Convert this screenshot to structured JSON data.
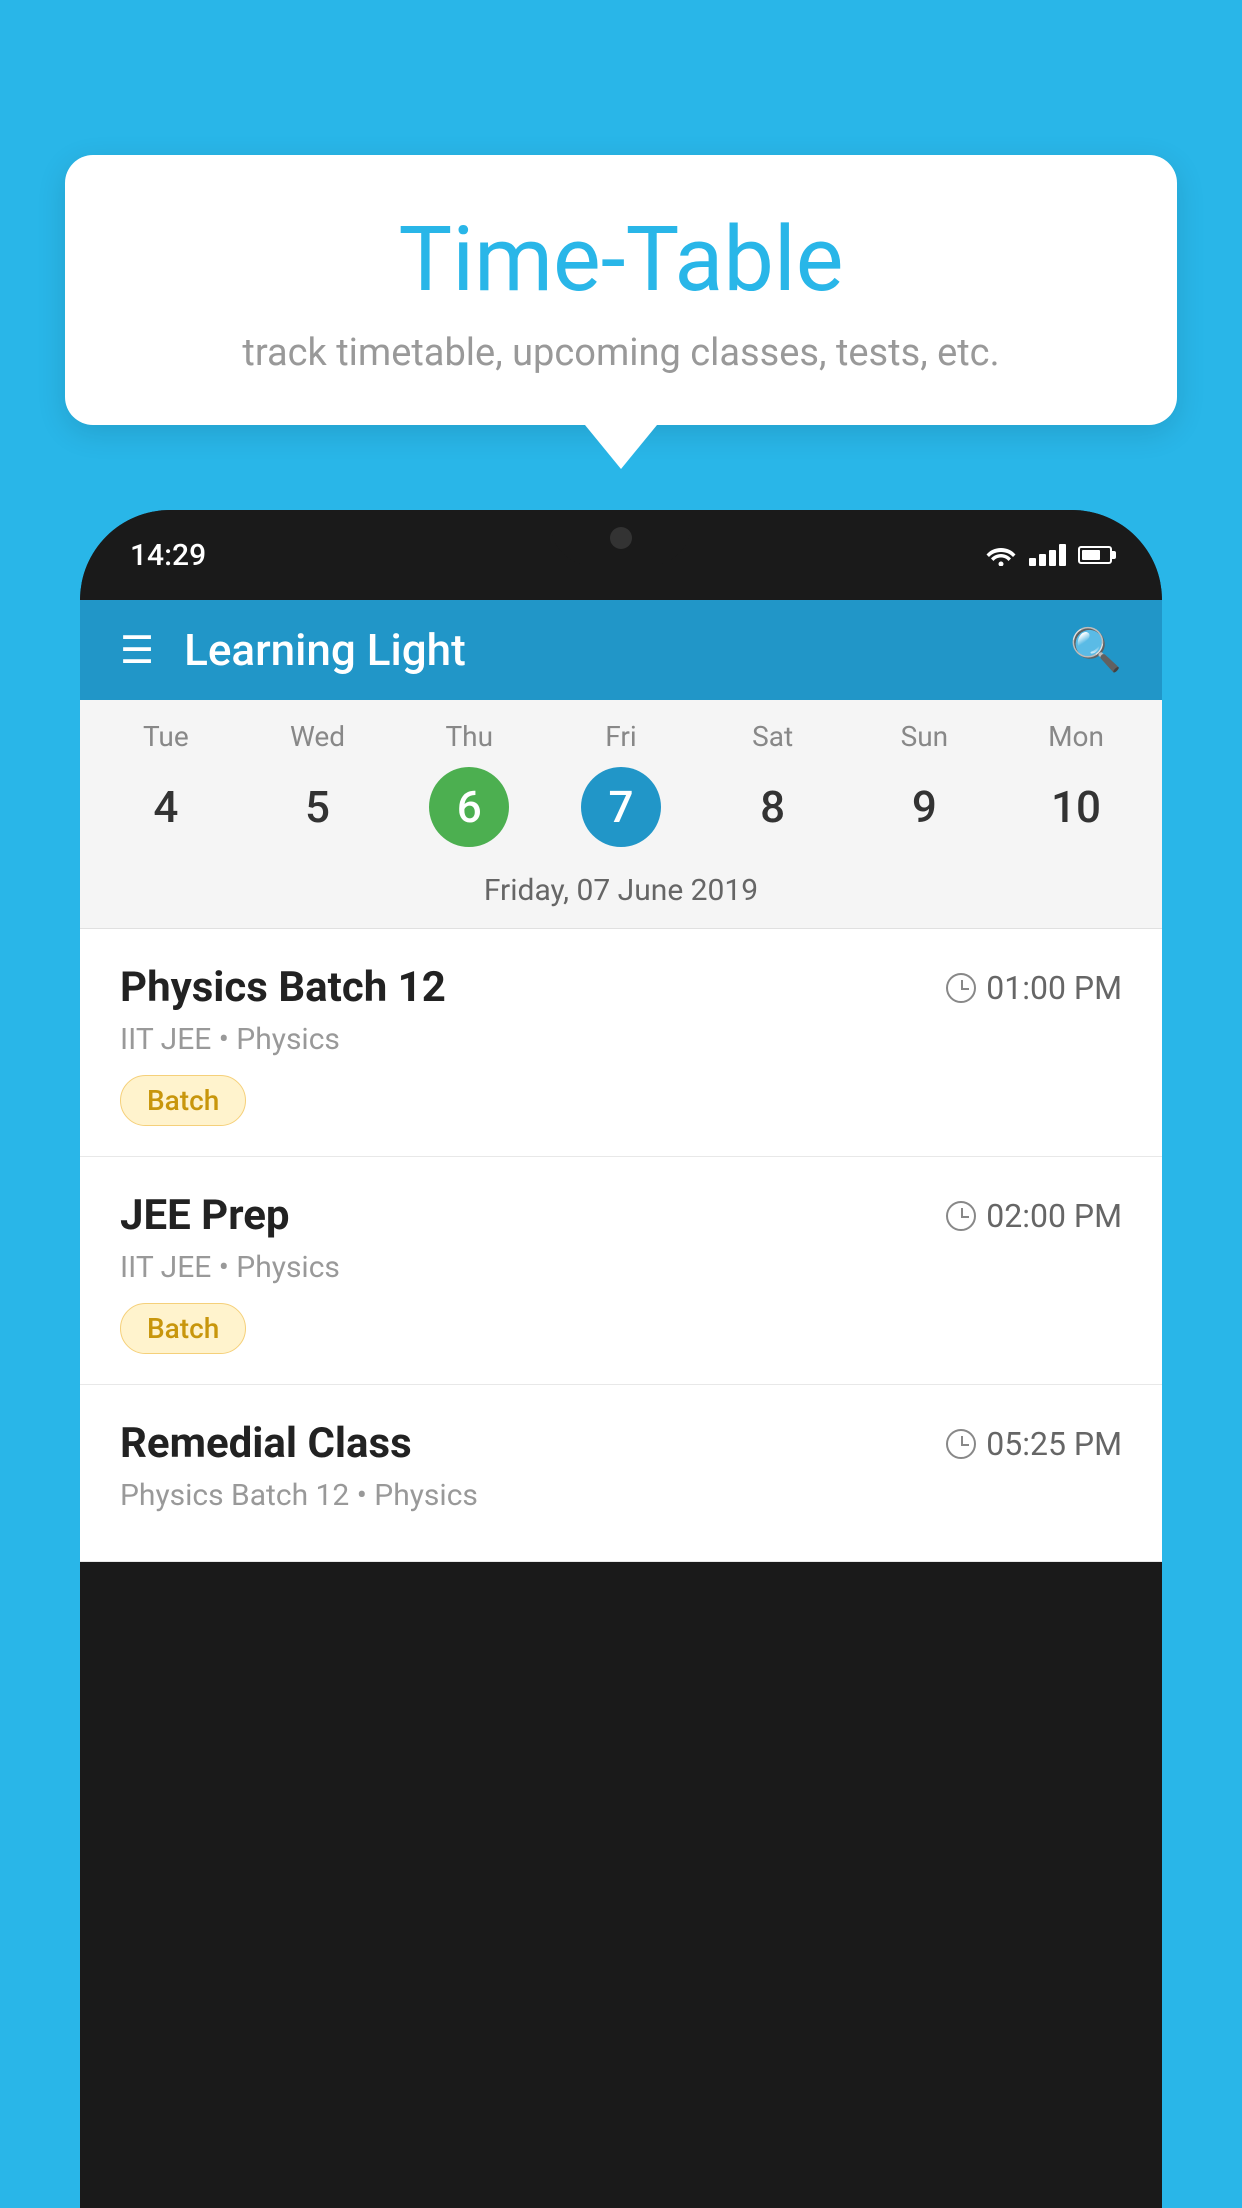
{
  "background_color": "#29b6e8",
  "tooltip": {
    "title": "Time-Table",
    "subtitle": "track timetable, upcoming classes, tests, etc."
  },
  "phone": {
    "status_bar": {
      "time": "14:29"
    },
    "app_header": {
      "title": "Learning Light"
    },
    "calendar": {
      "days": [
        {
          "name": "Tue",
          "num": "4",
          "state": "normal"
        },
        {
          "name": "Wed",
          "num": "5",
          "state": "normal"
        },
        {
          "name": "Thu",
          "num": "6",
          "state": "today"
        },
        {
          "name": "Fri",
          "num": "7",
          "state": "selected"
        },
        {
          "name": "Sat",
          "num": "8",
          "state": "normal"
        },
        {
          "name": "Sun",
          "num": "9",
          "state": "normal"
        },
        {
          "name": "Mon",
          "num": "10",
          "state": "normal"
        }
      ],
      "selected_date_label": "Friday, 07 June 2019"
    },
    "schedule": [
      {
        "title": "Physics Batch 12",
        "time": "01:00 PM",
        "subtitle": "IIT JEE • Physics",
        "badge": "Batch"
      },
      {
        "title": "JEE Prep",
        "time": "02:00 PM",
        "subtitle": "IIT JEE • Physics",
        "badge": "Batch"
      },
      {
        "title": "Remedial Class",
        "time": "05:25 PM",
        "subtitle": "Physics Batch 12 • Physics",
        "badge": null
      }
    ]
  }
}
